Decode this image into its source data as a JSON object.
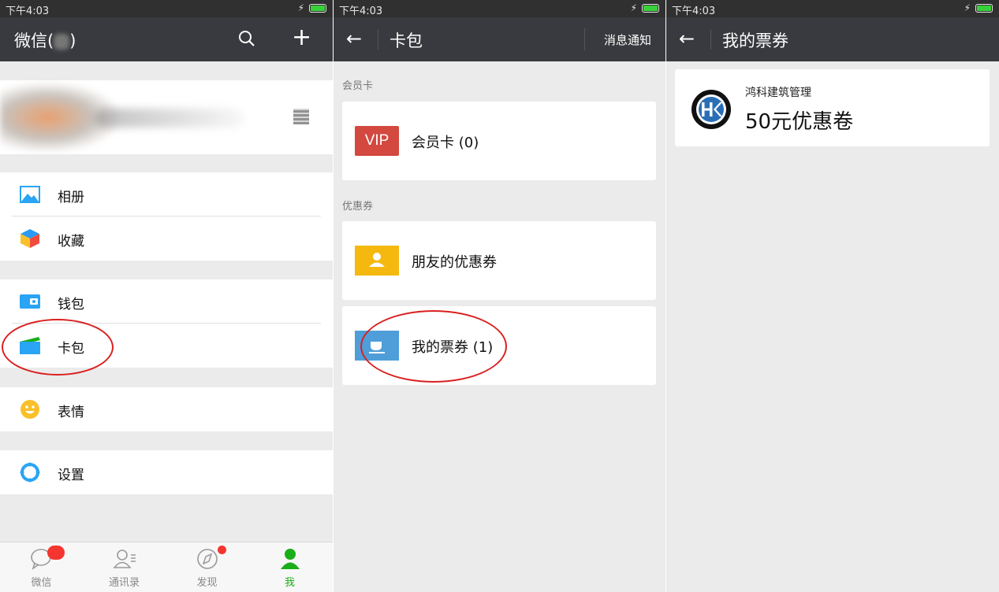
{
  "panel1": {
    "status_time": "下午4:03",
    "title": "微信(",
    "title_suffix": ")",
    "menu": {
      "album": "相册",
      "favorites": "收藏",
      "wallet": "钱包",
      "cards": "卡包",
      "stickers": "表情",
      "settings": "设置"
    },
    "tabs": [
      {
        "label": "微信"
      },
      {
        "label": "通讯录"
      },
      {
        "label": "发现"
      },
      {
        "label": "我"
      }
    ]
  },
  "panel2": {
    "status_time": "下午4:03",
    "title": "卡包",
    "right_action": "消息通知",
    "section_member": "会员卡",
    "vip_badge": "VIP",
    "member_card": "会员卡 (0)",
    "section_coupon": "优惠券",
    "friends_coupon": "朋友的优惠券",
    "my_tickets": "我的票券 (1)"
  },
  "panel3": {
    "status_time": "下午4:03",
    "title": "我的票券",
    "ticket": {
      "merchant": "鸿科建筑管理",
      "title": "50元优惠卷"
    }
  },
  "colors": {
    "titlebar": "#393a3f",
    "statusbar": "#303030",
    "background": "#ebebeb",
    "accent_green": "#1aad19",
    "annotation_red": "#d9201f",
    "vip_red": "#d3483f",
    "coupon_yellow": "#f5b80f",
    "ticket_blue": "#4f9ed9"
  }
}
